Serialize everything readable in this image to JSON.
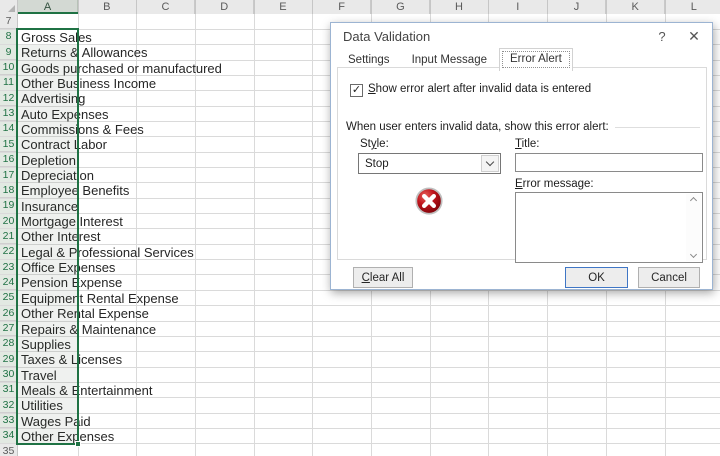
{
  "sheet": {
    "columns": [
      {
        "label": "A",
        "selected": true
      },
      {
        "label": "B",
        "selected": false
      },
      {
        "label": "C",
        "selected": false
      },
      {
        "label": "D",
        "selected": false
      },
      {
        "label": "E",
        "selected": false
      },
      {
        "label": "F",
        "selected": false
      },
      {
        "label": "G",
        "selected": false
      },
      {
        "label": "H",
        "selected": false
      },
      {
        "label": "I",
        "selected": false
      },
      {
        "label": "J",
        "selected": false
      },
      {
        "label": "K",
        "selected": false
      },
      {
        "label": "L",
        "selected": false
      }
    ],
    "rows": [
      {
        "n": "7",
        "label": "",
        "selected": false
      },
      {
        "n": "8",
        "label": "Gross Sales",
        "selected": true
      },
      {
        "n": "9",
        "label": "Returns & Allowances",
        "selected": true
      },
      {
        "n": "10",
        "label": "Goods purchased or manufactured",
        "selected": true
      },
      {
        "n": "11",
        "label": "Other Business Income",
        "selected": true
      },
      {
        "n": "12",
        "label": "Advertising",
        "selected": true
      },
      {
        "n": "13",
        "label": "Auto Expenses",
        "selected": true
      },
      {
        "n": "14",
        "label": "Commissions & Fees",
        "selected": true
      },
      {
        "n": "15",
        "label": "Contract Labor",
        "selected": true
      },
      {
        "n": "16",
        "label": "Depletion",
        "selected": true
      },
      {
        "n": "17",
        "label": "Depreciation",
        "selected": true
      },
      {
        "n": "18",
        "label": "Employee Benefits",
        "selected": true
      },
      {
        "n": "19",
        "label": "Insurance",
        "selected": true
      },
      {
        "n": "20",
        "label": "Mortgage Interest",
        "selected": true
      },
      {
        "n": "21",
        "label": "Other Interest",
        "selected": true
      },
      {
        "n": "22",
        "label": "Legal & Professional Services",
        "selected": true
      },
      {
        "n": "23",
        "label": "Office Expenses",
        "selected": true
      },
      {
        "n": "24",
        "label": "Pension Expense",
        "selected": true
      },
      {
        "n": "25",
        "label": "Equipment Rental Expense",
        "selected": true
      },
      {
        "n": "26",
        "label": "Other Rental Expense",
        "selected": true
      },
      {
        "n": "27",
        "label": "Repairs & Maintenance",
        "selected": true
      },
      {
        "n": "28",
        "label": "Supplies",
        "selected": true
      },
      {
        "n": "29",
        "label": "Taxes & Licenses",
        "selected": true
      },
      {
        "n": "30",
        "label": "Travel",
        "selected": true
      },
      {
        "n": "31",
        "label": "Meals & Entertainment",
        "selected": true
      },
      {
        "n": "32",
        "label": "Utilities",
        "selected": true
      },
      {
        "n": "33",
        "label": "Wages Paid",
        "selected": true
      },
      {
        "n": "34",
        "label": "Other Expenses",
        "selected": true
      },
      {
        "n": "35",
        "label": "",
        "selected": false
      }
    ],
    "selection_color": "#1f7244"
  },
  "dialog": {
    "title": "Data Validation",
    "help_glyph": "?",
    "close_glyph": "✕",
    "tabs": [
      {
        "label": "Settings",
        "active": false
      },
      {
        "label": "Input Message",
        "active": false
      },
      {
        "label": "Error Alert",
        "active": true
      }
    ],
    "checkbox": {
      "checked": true,
      "glyph": "✓",
      "pre": "",
      "key": "S",
      "post": "how error alert after invalid data is entered"
    },
    "group_label": "When user enters invalid data, show this error alert:",
    "style_field": {
      "pre": "St",
      "key": "y",
      "post": "le:",
      "value": "Stop"
    },
    "title_field": {
      "pre": "",
      "key": "T",
      "post": "itle:",
      "value": ""
    },
    "message_field": {
      "pre": "",
      "key": "E",
      "post": "rror message:",
      "value": ""
    },
    "stop_icon_colors": {
      "red": "#c0161e",
      "ring": "#bfbfbf",
      "x": "#ffffff"
    },
    "buttons": {
      "clear_all": {
        "pre": "",
        "key": "C",
        "post": "lear All"
      },
      "ok": "OK",
      "cancel": "Cancel"
    }
  }
}
